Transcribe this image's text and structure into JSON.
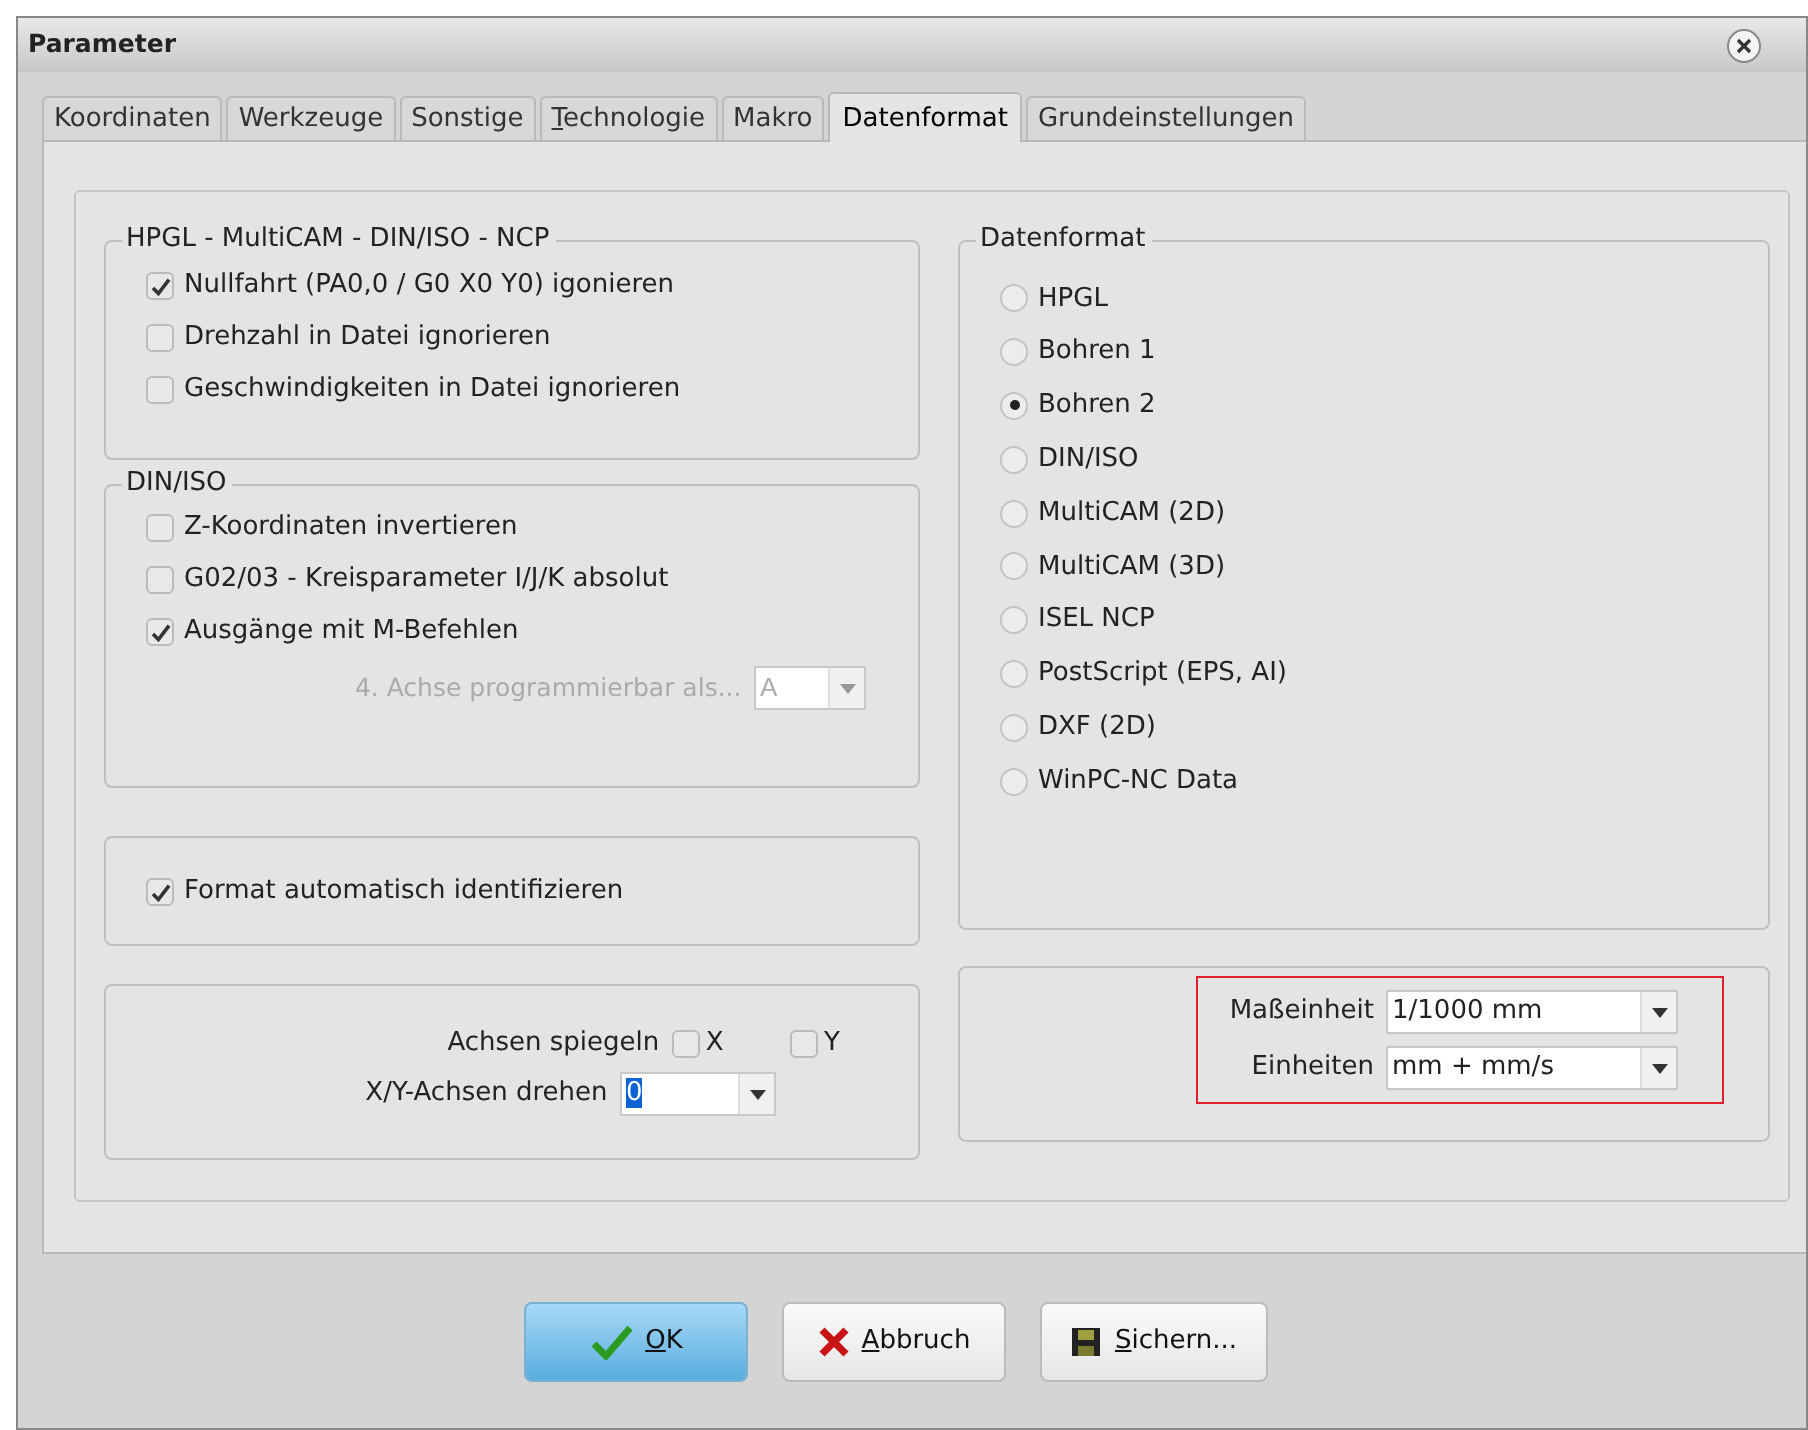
{
  "window": {
    "title": "Parameter"
  },
  "tabs": [
    {
      "label": "Koordinaten",
      "selected": false,
      "mnemonic": false
    },
    {
      "label": "Werkzeuge",
      "selected": false,
      "mnemonic": false
    },
    {
      "label": "Sonstige",
      "selected": false,
      "mnemonic": false
    },
    {
      "label": "Technologie",
      "selected": false,
      "mnemonic": true
    },
    {
      "label": "Makro",
      "selected": false,
      "mnemonic": false
    },
    {
      "label": "Datenformat",
      "selected": true,
      "mnemonic": false
    },
    {
      "label": "Grundeinstellungen",
      "selected": false,
      "mnemonic": false
    }
  ],
  "hpgl_group": {
    "title": "HPGL - MultiCAM - DIN/ISO - NCP",
    "options": [
      {
        "label": "Nullfahrt (PA0,0 / G0 X0 Y0) igonieren",
        "checked": true
      },
      {
        "label": "Drehzahl in Datei ignorieren",
        "checked": false
      },
      {
        "label": "Geschwindigkeiten in Datei ignorieren",
        "checked": false
      }
    ]
  },
  "din_iso_group": {
    "title": "DIN/ISO",
    "options": [
      {
        "label": "Z-Koordinaten invertieren",
        "checked": false
      },
      {
        "label": "G02/03 - Kreisparameter I/J/K absolut",
        "checked": false
      },
      {
        "label": "Ausgänge mit M-Befehlen",
        "checked": true
      }
    ],
    "axis4": {
      "label": "4. Achse programmierbar als...",
      "value": "A",
      "disabled": true
    }
  },
  "auto_format": {
    "label": "Format automatisch identifizieren",
    "checked": true
  },
  "axes": {
    "mirror_label": "Achsen spiegeln",
    "mirror": [
      {
        "label": "X",
        "checked": false
      },
      {
        "label": "Y",
        "checked": false
      }
    ],
    "rotate_label": "X/Y-Achsen drehen",
    "rotate_value": "0",
    "value_highlighted": true
  },
  "datenformat": {
    "title": "Datenformat",
    "options": [
      {
        "label": "HPGL",
        "selected": false
      },
      {
        "label": "Bohren 1",
        "selected": false
      },
      {
        "label": "Bohren 2",
        "selected": true
      },
      {
        "label": "DIN/ISO",
        "selected": false
      },
      {
        "label": "MultiCAM (2D)",
        "selected": false
      },
      {
        "label": "MultiCAM (3D)",
        "selected": false
      },
      {
        "label": "ISEL NCP",
        "selected": false
      },
      {
        "label": "PostScript (EPS, AI)",
        "selected": false
      },
      {
        "label": "DXF (2D)",
        "selected": false
      },
      {
        "label": "WinPC-NC Data",
        "selected": false
      }
    ]
  },
  "units": {
    "highlighted": true,
    "rows": [
      {
        "label": "Maßeinheit",
        "value": "1/1000 mm"
      },
      {
        "label": "Einheiten",
        "value": "mm + mm/s"
      }
    ]
  },
  "buttons": [
    {
      "label": "OK",
      "kind": "ok",
      "default": true,
      "mnemonic": true
    },
    {
      "label": "Abbruch",
      "kind": "cancel",
      "default": false,
      "mnemonic": true
    },
    {
      "label": "Sichern...",
      "kind": "save",
      "default": false,
      "mnemonic": true
    }
  ]
}
